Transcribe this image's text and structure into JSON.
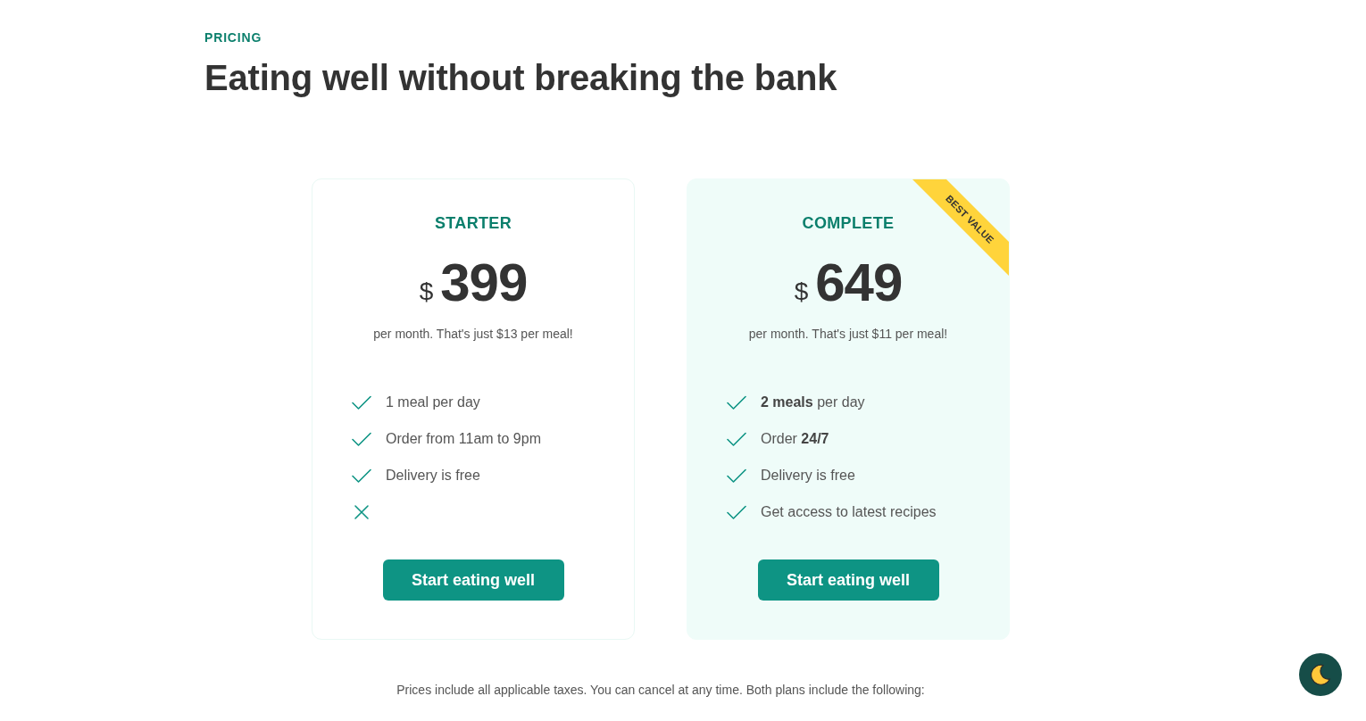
{
  "header": {
    "eyebrow": "PRICING",
    "title": "Eating well without breaking the bank"
  },
  "plans": [
    {
      "name": "STARTER",
      "featured": false,
      "currency": "$",
      "price": "399",
      "note": "per month. That's just $13 per meal!",
      "features": [
        {
          "text": "1 meal per day",
          "included": true
        },
        {
          "text": "Order from 11am to 9pm",
          "included": true
        },
        {
          "text": "Delivery is free",
          "included": true
        },
        {
          "included": false
        }
      ],
      "button": "Start eating well"
    },
    {
      "name": "COMPLETE",
      "featured": true,
      "ribbon": "BEST VALUE",
      "currency": "$",
      "price": "649",
      "note": "per month. That's just $11 per meal!",
      "features": [
        {
          "text": "**2 meals** per day",
          "included": true
        },
        {
          "text": "Order **24/7**",
          "included": true
        },
        {
          "text": "Delivery is free",
          "included": true
        },
        {
          "text": "Get access to latest recipes",
          "included": true
        }
      ],
      "button": "Start eating well"
    }
  ],
  "footnote": "Prices include all applicable taxes. You can cancel at any time. Both plans include the following:"
}
